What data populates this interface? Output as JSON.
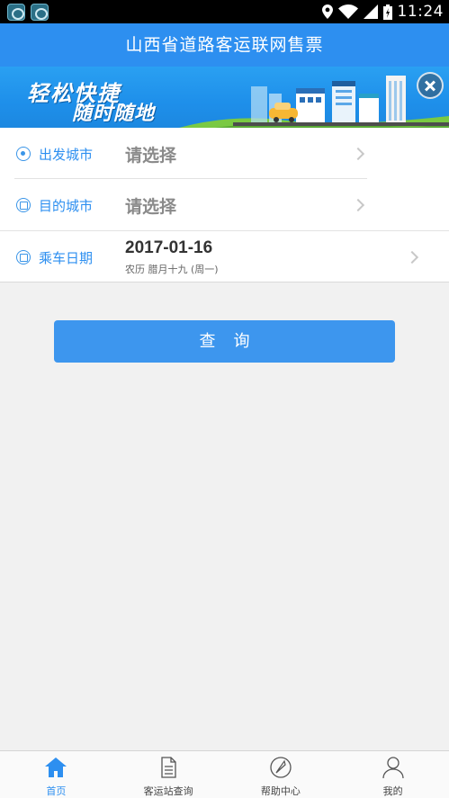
{
  "status_bar": {
    "time": "11:24"
  },
  "header": {
    "title": "山西省道路客运联网售票"
  },
  "banner": {
    "slogan_line1": "轻松快捷",
    "slogan_line2": "随时随地"
  },
  "form": {
    "departure": {
      "label": "出发城市",
      "value": "请选择"
    },
    "destination": {
      "label": "目的城市",
      "value": "请选择"
    },
    "date": {
      "label": "乘车日期",
      "value": "2017-01-16",
      "lunar": "农历 腊月十九 (周一)"
    }
  },
  "query_button": {
    "label": "查询"
  },
  "bottom_nav": {
    "items": [
      {
        "label": "首页",
        "icon": "home-icon",
        "active": true
      },
      {
        "label": "客运站查询",
        "icon": "document-icon",
        "active": false
      },
      {
        "label": "帮助中心",
        "icon": "help-icon",
        "active": false
      },
      {
        "label": "我的",
        "icon": "user-icon",
        "active": false
      }
    ]
  },
  "colors": {
    "primary": "#2d8ff0",
    "button": "#3d96ee",
    "background": "#f1f1f1"
  }
}
